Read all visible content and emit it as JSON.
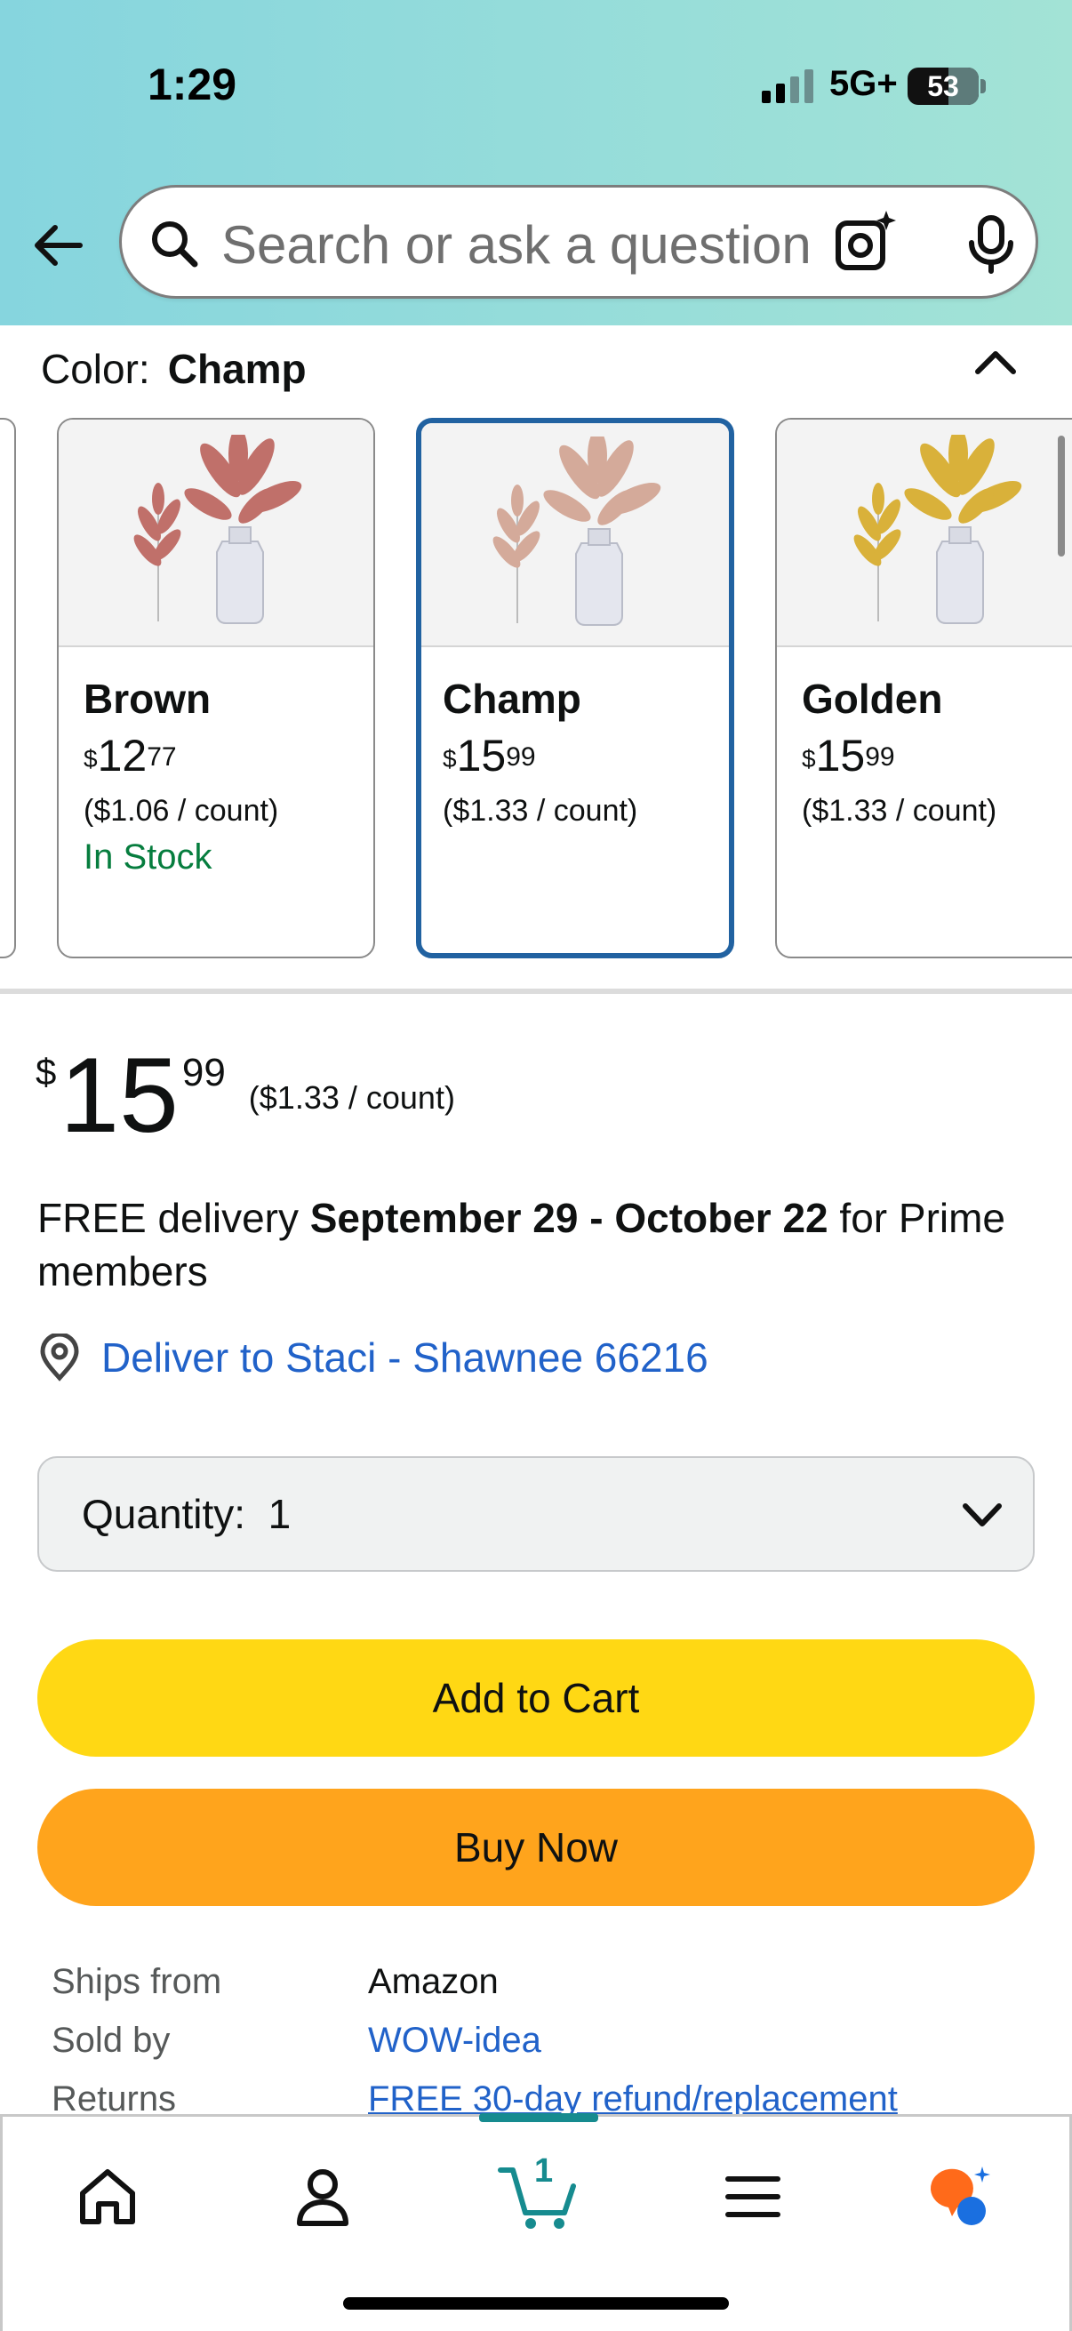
{
  "status_bar": {
    "time": "1:29",
    "network": "5G+",
    "battery": "53"
  },
  "search": {
    "placeholder": "Search or ask a question"
  },
  "color": {
    "label": "Color:",
    "selected": "Champ"
  },
  "swatches": [
    {
      "name": "Brown",
      "price_symbol": "$",
      "price_whole": "12",
      "price_cents": "77",
      "unit": "($1.06 / count)",
      "stock": "In Stock",
      "leaf_color": "#c0706a"
    },
    {
      "name": "Champ",
      "price_symbol": "$",
      "price_whole": "15",
      "price_cents": "99",
      "unit": "($1.33 / count)",
      "stock": "",
      "leaf_color": "#d4aa9a"
    },
    {
      "name": "Golden",
      "price_symbol": "$",
      "price_whole": "15",
      "price_cents": "99",
      "unit": "($1.33 / count)",
      "stock": "",
      "leaf_color": "#d9b13a"
    }
  ],
  "price": {
    "symbol": "$",
    "whole": "15",
    "cents": "99",
    "per_unit": "($1.33 / count)"
  },
  "delivery": {
    "prefix": "FREE delivery ",
    "dates": "September 29 - October 22",
    "suffix": " for Prime members"
  },
  "deliver_to": "Deliver to Staci - Shawnee 66216",
  "quantity": {
    "label": "Quantity:",
    "value": "1"
  },
  "buttons": {
    "add_to_cart": "Add to Cart",
    "buy_now": "Buy Now"
  },
  "meta": [
    {
      "key": "Ships from",
      "value": "Amazon"
    },
    {
      "key": "Sold by",
      "value": "WOW-idea"
    },
    {
      "key": "Returns",
      "value": "FREE 30-day refund/replacement"
    }
  ],
  "nav": {
    "cart_count": "1"
  },
  "colors": {
    "accent_blue": "#2162a1",
    "link": "#2162c9",
    "cart_button": "#ffd814",
    "buy_button": "#ffa41c",
    "in_stock": "#067d3e"
  }
}
